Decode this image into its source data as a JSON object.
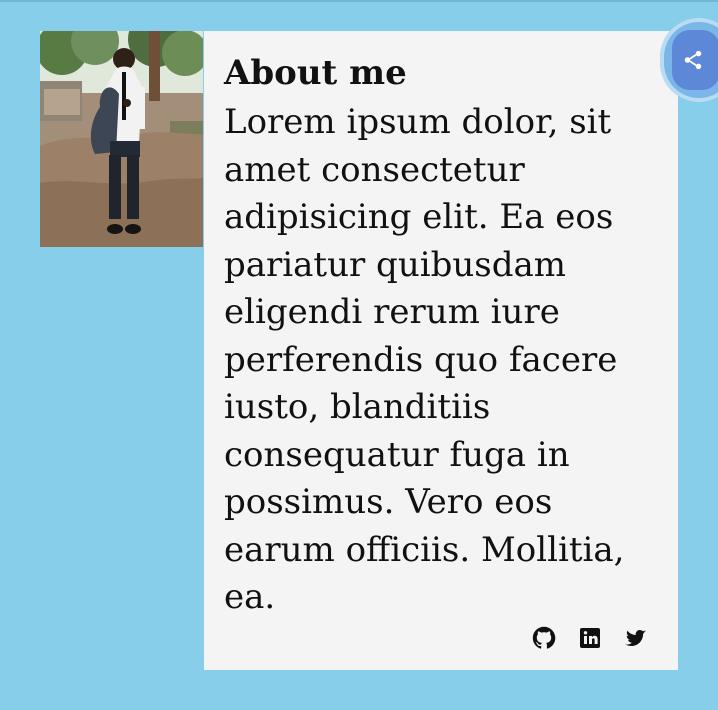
{
  "about": {
    "title": "About me",
    "body": "Lorem ipsum dolor, sit amet consectetur adipisicing elit. Ea eos pariatur quibusdam eligendi rerum iure perferendis quo facere iusto, blanditiis consequatur fuga in possimus. Vero eos earum officiis. Mollitia, ea."
  },
  "social": {
    "items": [
      {
        "icon": "github-icon"
      },
      {
        "icon": "linkedin-icon"
      },
      {
        "icon": "twitter-icon"
      }
    ]
  },
  "sideButton": {
    "icon": "share-icon"
  },
  "colors": {
    "background": "#87ceeb",
    "card": "#f4f4f4",
    "text": "#111111",
    "accent": "#5d87d7"
  }
}
